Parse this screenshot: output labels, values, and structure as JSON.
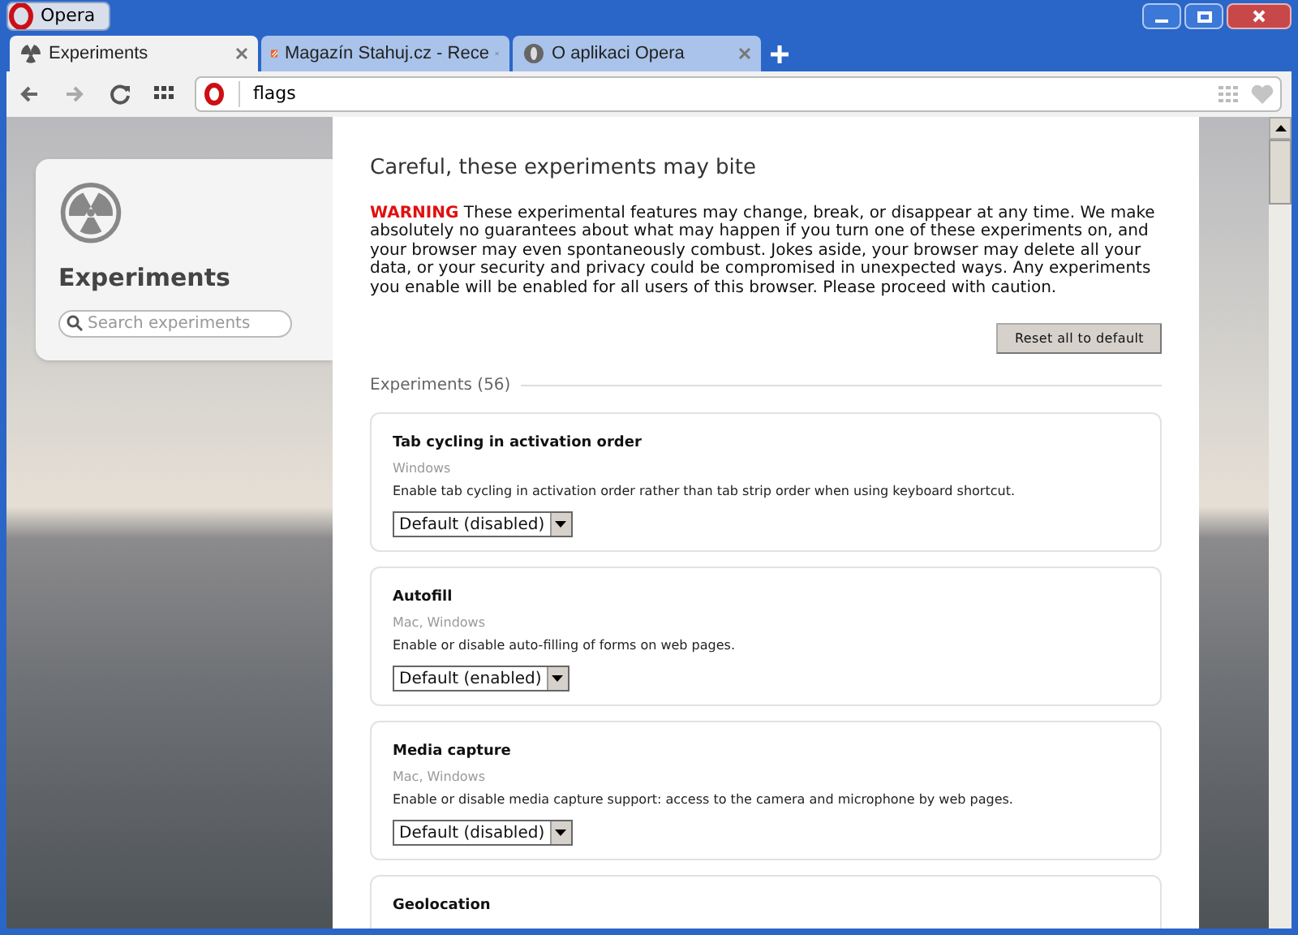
{
  "window": {
    "title": "Opera"
  },
  "tabs": [
    {
      "label": "Experiments",
      "selected": true
    },
    {
      "label": "Magazín Stahuj.cz - Rece",
      "selected": false
    },
    {
      "label": "O aplikaci Opera",
      "selected": false
    }
  ],
  "address_bar": {
    "value": "flags"
  },
  "sidebar": {
    "title": "Experiments",
    "search": {
      "placeholder": "Search experiments"
    }
  },
  "main": {
    "heading": "Careful, these experiments may bite",
    "warning_label": "WARNING",
    "warning_text": "These experimental features may change, break, or disappear at any time. We make absolutely no guarantees about what may happen if you turn one of these experiments on, and your browser may even spontaneously combust. Jokes aside, your browser may delete all your data, or your security and privacy could be compromised in unexpected ways. Any experiments you enable will be enabled for all users of this browser. Please proceed with caution.",
    "reset_button": "Reset all to default",
    "section_label": "Experiments (56)",
    "experiments": [
      {
        "title": "Tab cycling in activation order",
        "platforms": "Windows",
        "description": "Enable tab cycling in activation order rather than tab strip order when using keyboard shortcut.",
        "value": "Default (disabled)"
      },
      {
        "title": "Autofill",
        "platforms": "Mac, Windows",
        "description": "Enable or disable auto-filling of forms on web pages.",
        "value": "Default (enabled)"
      },
      {
        "title": "Media capture",
        "platforms": "Mac, Windows",
        "description": "Enable or disable media capture support: access to the camera and microphone by web pages.",
        "value": "Default (disabled)"
      },
      {
        "title": "Geolocation"
      }
    ]
  }
}
